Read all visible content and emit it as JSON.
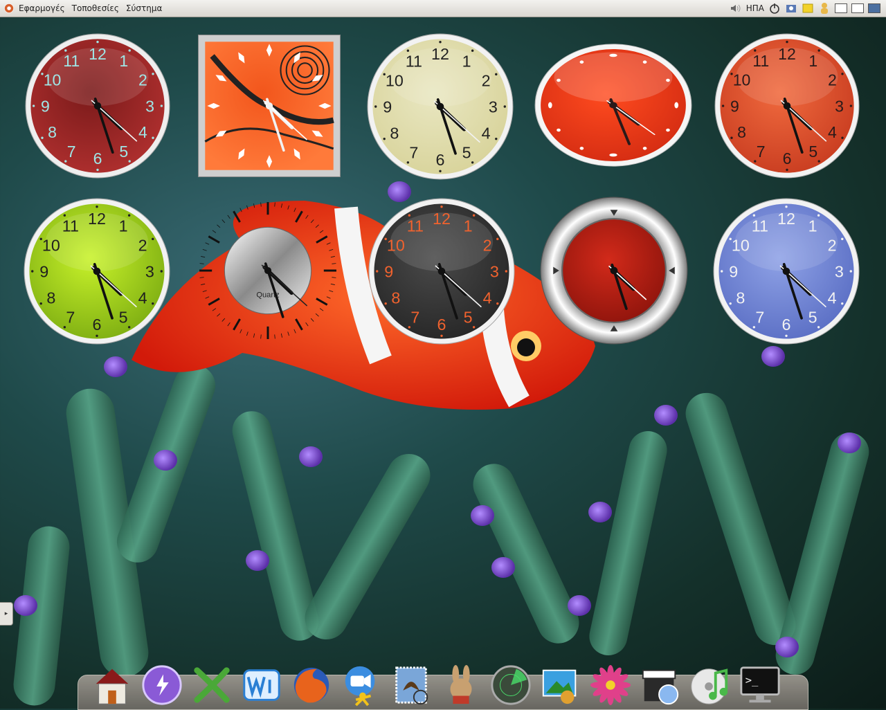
{
  "top_panel": {
    "menus": [
      "Εφαρμογές",
      "Τοποθεσίες",
      "Σύστημα"
    ],
    "keyboard_layout": "ΗΠΑ",
    "tray_icons": [
      "volume-icon",
      "power-icon",
      "puzzle-icon",
      "notes-icon",
      "user-icon"
    ],
    "workspaces": 3,
    "active_workspace": 3
  },
  "clocks": [
    {
      "name": "clock-red-dark",
      "face": "#7a1a1a",
      "face2": "#b0302f",
      "numcolor": "#9fe6e6",
      "rim": "#eeeeee",
      "numerals": true,
      "time": {
        "h": 4,
        "m": 27,
        "s": 22
      }
    },
    {
      "name": "clock-orange-square",
      "face": "#f2561c",
      "face2": "#ff7a3a",
      "numcolor": "#ffffff",
      "rim": "#bdbdbd",
      "numerals": false,
      "square": true,
      "time": {
        "h": 4,
        "m": 27,
        "s": 22
      }
    },
    {
      "name": "clock-cream",
      "face": "#e9e7c2",
      "face2": "#d8d39a",
      "numcolor": "#222222",
      "rim": "#f2f2f2",
      "numerals": true,
      "time": {
        "h": 4,
        "m": 27,
        "s": 22
      }
    },
    {
      "name": "clock-red-oval",
      "face": "#ff4b1f",
      "face2": "#d42c12",
      "numcolor": "#ffffff",
      "rim": "#f2f2f2",
      "numerals": false,
      "oval": true,
      "time": {
        "h": 4,
        "m": 27,
        "s": 22
      }
    },
    {
      "name": "clock-salmon",
      "face": "#f06a3e",
      "face2": "#c83c20",
      "numcolor": "#2a1a1a",
      "rim": "#f2f2f2",
      "numerals": true,
      "time": {
        "h": 4,
        "m": 27,
        "s": 22
      }
    },
    {
      "name": "clock-lime",
      "face": "#c8f22a",
      "face2": "#7dad12",
      "numcolor": "#1f1f1f",
      "rim": "#f2f2f2",
      "numerals": true,
      "time": {
        "h": 4,
        "m": 27,
        "s": 22
      }
    },
    {
      "name": "clock-quartz",
      "label": "Quartz",
      "numerals": false,
      "quartz": true,
      "time": {
        "h": 4,
        "m": 27,
        "s": 22
      }
    },
    {
      "name": "clock-dark",
      "face": "#4a4a4a",
      "face2": "#262626",
      "numcolor": "#f0622e",
      "rim": "#f2f2f2",
      "numerals": true,
      "time": {
        "h": 4,
        "m": 27,
        "s": 22
      }
    },
    {
      "name": "clock-chrome-red",
      "face": "#d22a1a",
      "face2": "#8e140c",
      "numcolor": "#ffffff",
      "rim": "#d8d8d8",
      "numerals": false,
      "chrome": true,
      "time": {
        "h": 4,
        "m": 27,
        "s": 22
      }
    },
    {
      "name": "clock-blue",
      "face": "#8fa2e6",
      "face2": "#5a6ec4",
      "numcolor": "#f2f2f2",
      "rim": "#f2f2f2",
      "numerals": true,
      "time": {
        "h": 4,
        "m": 27,
        "s": 22
      }
    }
  ],
  "dock": {
    "items": [
      {
        "name": "home-folder-icon",
        "color": "#c9c4b8"
      },
      {
        "name": "purple-orb-icon",
        "color": "#8a5ad6"
      },
      {
        "name": "green-x-icon",
        "color": "#4aa838"
      },
      {
        "name": "wi-blue-icon",
        "color": "#2a7fd4"
      },
      {
        "name": "firefox-icon",
        "color": "#e8631c"
      },
      {
        "name": "video-chat-icon",
        "color": "#3b8de0"
      },
      {
        "name": "mail-stamp-icon",
        "color": "#7aa6d8"
      },
      {
        "name": "bunny-icon",
        "color": "#c8a070"
      },
      {
        "name": "radar-icon",
        "color": "#3a4a3a"
      },
      {
        "name": "image-editor-icon",
        "color": "#3aa0e0"
      },
      {
        "name": "flower-icon",
        "color": "#e0408a"
      },
      {
        "name": "movie-clapper-icon",
        "color": "#2a2a2a"
      },
      {
        "name": "music-disc-icon",
        "color": "#4ab84a"
      },
      {
        "name": "terminal-icon",
        "color": "#111111"
      }
    ],
    "terminal_prompt": ">_"
  }
}
